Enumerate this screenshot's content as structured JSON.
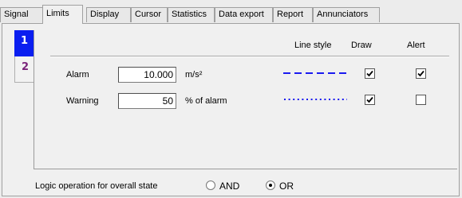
{
  "tabs": [
    {
      "label": "Signal"
    },
    {
      "label": "Limits"
    },
    {
      "label": "Display"
    },
    {
      "label": "Cursor"
    },
    {
      "label": "Statistics"
    },
    {
      "label": "Data export"
    },
    {
      "label": "Report"
    },
    {
      "label": "Annunciators"
    }
  ],
  "active_tab": "Limits",
  "side_tabs": [
    {
      "label": "1",
      "color": "#0a1ef0"
    },
    {
      "label": "2",
      "color": "#7a237a"
    }
  ],
  "columns": {
    "line_style": "Line style",
    "draw": "Draw",
    "alert": "Alert"
  },
  "rows": [
    {
      "label": "Alarm",
      "value": "10.000",
      "unit": "m/s²",
      "line_style": "dashed",
      "line_color": "#1a1af0",
      "draw": true,
      "alert": true
    },
    {
      "label": "Warning",
      "value": "50",
      "unit": "% of alarm",
      "line_style": "dotted",
      "line_color": "#1a1af0",
      "draw": true,
      "alert": false
    }
  ],
  "logic": {
    "label": "Logic operation for overall state",
    "options": [
      {
        "label": "AND",
        "selected": false
      },
      {
        "label": "OR",
        "selected": true
      }
    ]
  }
}
